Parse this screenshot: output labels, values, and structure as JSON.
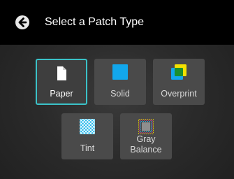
{
  "header": {
    "title": "Select a Patch Type",
    "back_icon": "arrow-left-circle-icon"
  },
  "tiles": [
    {
      "id": "paper",
      "label": "Paper",
      "icon": "document-icon",
      "selected": true
    },
    {
      "id": "solid",
      "label": "Solid",
      "icon": "solid-square-icon",
      "selected": false
    },
    {
      "id": "overprint",
      "label": "Overprint",
      "icon": "overprint-squares-icon",
      "selected": false
    },
    {
      "id": "tint",
      "label": "Tint",
      "icon": "halftone-tint-icon",
      "selected": false
    },
    {
      "id": "gray-balance",
      "label_line1": "Gray",
      "label_line2": "Balance",
      "icon": "gray-balance-icon",
      "selected": false
    }
  ],
  "colors": {
    "selected_border": "#3bc2c8",
    "solid_blue": "#12a7ec",
    "overprint_yellow": "#f4e100",
    "overprint_green": "#1a8f2e",
    "tint_cyan": "#1fb6ea",
    "gray_balance_gray": "#8e8e8e"
  }
}
